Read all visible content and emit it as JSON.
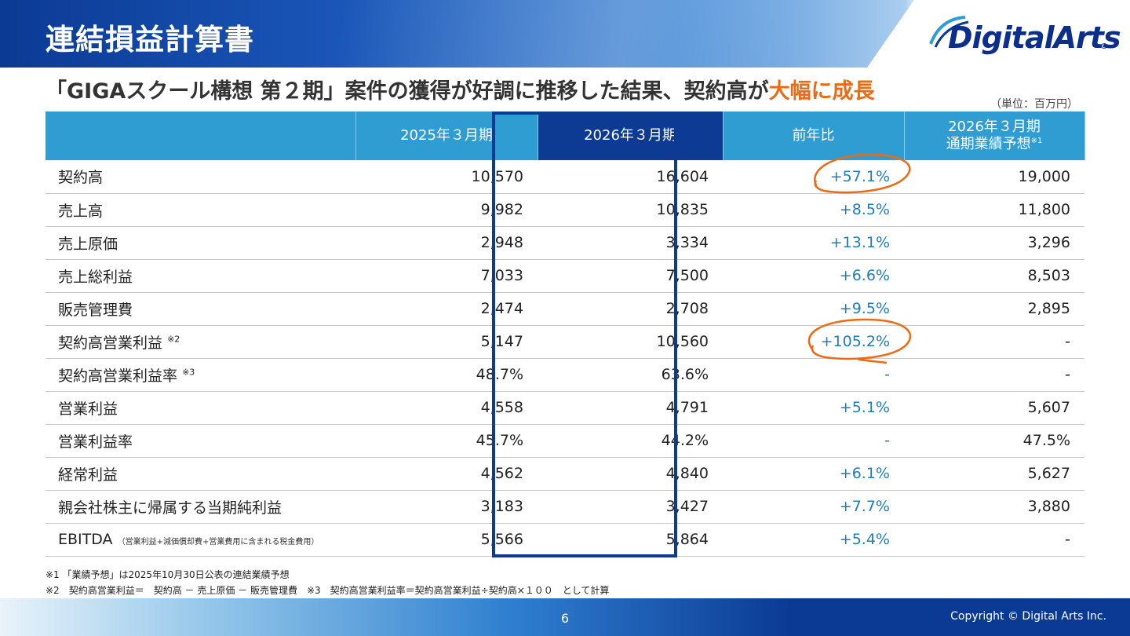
{
  "header": {
    "title": "連結損益計算書",
    "logo": "DigitalArts",
    "logo_reg": "®"
  },
  "headline": {
    "prefix": "「GIGAスクール構想 第２期」案件の獲得が好調に推移した結果、契約高が",
    "accent": "大幅に成長"
  },
  "unit": "（単位：百万円）",
  "table": {
    "columns": {
      "label": "",
      "fy2025": "2025年３月期",
      "fy2026": "2026年３月期",
      "yoy": "前年比",
      "forecast_line1": "2026年３月期",
      "forecast_line2": "通期業績予想",
      "forecast_note": "※1"
    },
    "rows": [
      {
        "label": "契約高",
        "note": "",
        "sub": "",
        "fy2025": "10,570",
        "fy2026": "16,604",
        "yoy": "+57.1%",
        "forecast": "19,000"
      },
      {
        "label": "売上高",
        "note": "",
        "sub": "",
        "fy2025": "9,982",
        "fy2026": "10,835",
        "yoy": "+8.5%",
        "forecast": "11,800"
      },
      {
        "label": "売上原価",
        "note": "",
        "sub": "",
        "fy2025": "2,948",
        "fy2026": "3,334",
        "yoy": "+13.1%",
        "forecast": "3,296"
      },
      {
        "label": "売上総利益",
        "note": "",
        "sub": "",
        "fy2025": "7,033",
        "fy2026": "7,500",
        "yoy": "+6.6%",
        "forecast": "8,503"
      },
      {
        "label": "販売管理費",
        "note": "",
        "sub": "",
        "fy2025": "2,474",
        "fy2026": "2,708",
        "yoy": "+9.5%",
        "forecast": "2,895"
      },
      {
        "label": "契約高営業利益",
        "note": "※2",
        "sub": "",
        "fy2025": "5,147",
        "fy2026": "10,560",
        "yoy": "+105.2%",
        "forecast": "-"
      },
      {
        "label": "契約高営業利益率",
        "note": "※3",
        "sub": "",
        "fy2025": "48.7%",
        "fy2026": "63.6%",
        "yoy": "-",
        "forecast": "-"
      },
      {
        "label": "営業利益",
        "note": "",
        "sub": "",
        "fy2025": "4,558",
        "fy2026": "4,791",
        "yoy": "+5.1%",
        "forecast": "5,607"
      },
      {
        "label": "営業利益率",
        "note": "",
        "sub": "",
        "fy2025": "45.7%",
        "fy2026": "44.2%",
        "yoy": "-",
        "forecast": "47.5%"
      },
      {
        "label": "経常利益",
        "note": "",
        "sub": "",
        "fy2025": "4,562",
        "fy2026": "4,840",
        "yoy": "+6.1%",
        "forecast": "5,627"
      },
      {
        "label": "親会社株主に帰属する当期純利益",
        "note": "",
        "sub": "",
        "fy2025": "3,183",
        "fy2026": "3,427",
        "yoy": "+7.7%",
        "forecast": "3,880"
      },
      {
        "label": "EBITDA",
        "note": "",
        "sub": "（営業利益+減価償却費+営業費用に含まれる税金費用）",
        "fy2025": "5,566",
        "fy2026": "5,864",
        "yoy": "+5.4%",
        "forecast": "-"
      }
    ]
  },
  "footnotes": {
    "line1": "※1 「業績予想」は2025年10月30日公表の連結業績予想",
    "line2": "※2　契約高営業利益＝　契約高 － 売上原価 － 販売管理費　※3　契約高営業利益率＝契約高営業利益÷契約高×１００　として計算"
  },
  "footer": {
    "page": "6",
    "copyright": "Copyright © Digital Arts Inc."
  },
  "colors": {
    "header_blue": "#0b3a94",
    "table_header": "#2f9dd2",
    "highlight_column": "#0d3a93",
    "yoy_text": "#1f7dbf",
    "accent_orange": "#ec6a14"
  }
}
